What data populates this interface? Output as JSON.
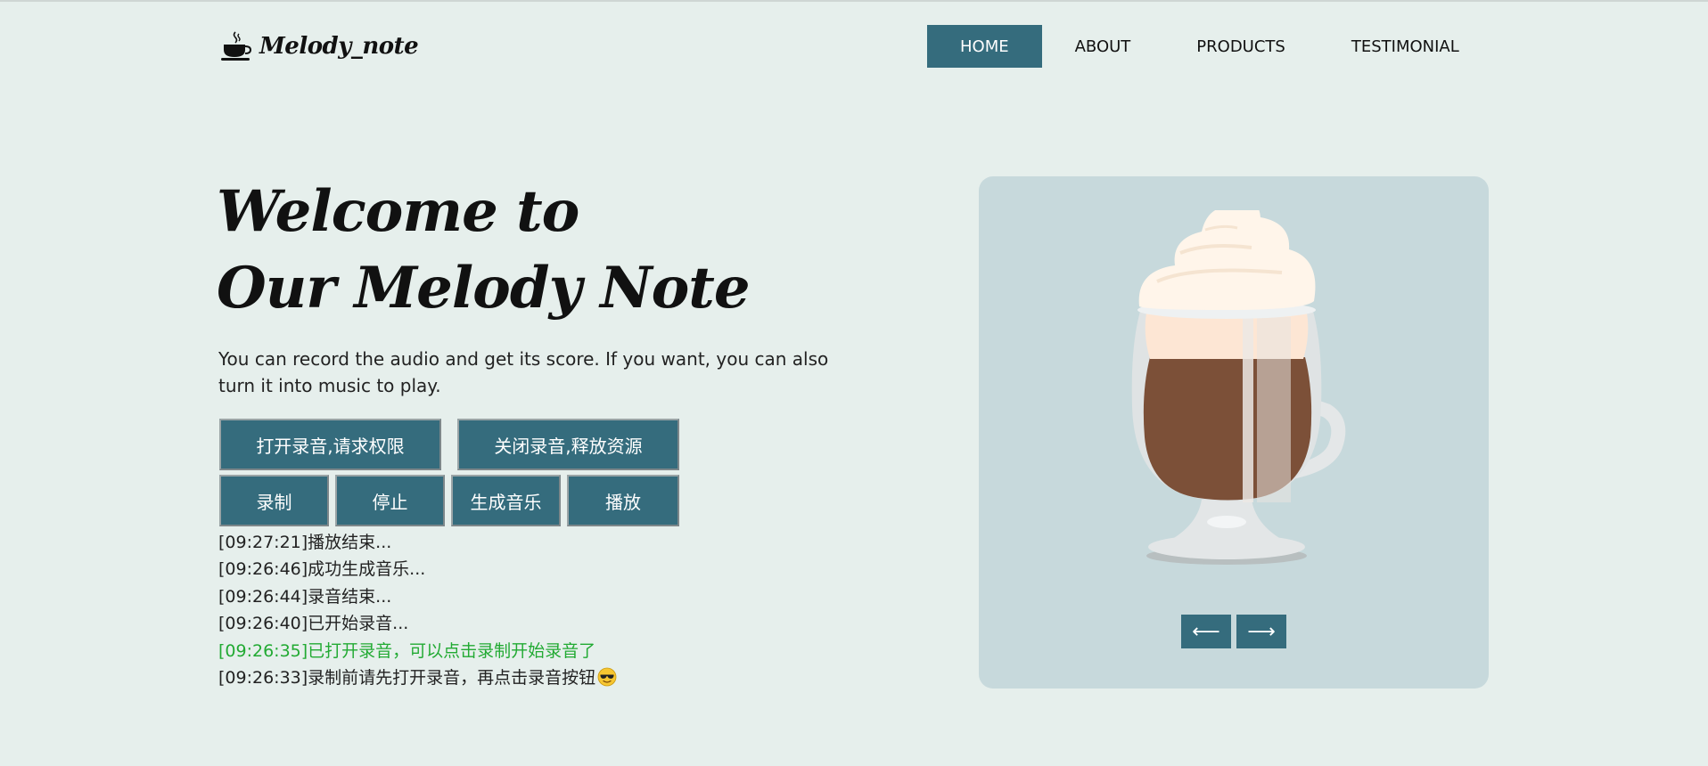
{
  "brand": {
    "name": "Melody_note",
    "icon": "coffee-cup-icon"
  },
  "nav": [
    {
      "label": "HOME",
      "active": true
    },
    {
      "label": "ABOUT",
      "active": false
    },
    {
      "label": "PRODUCTS",
      "active": false
    },
    {
      "label": "TESTIMONIAL",
      "active": false
    }
  ],
  "hero": {
    "title_line1": "Welcome to",
    "title_line2": "Our Melody Note",
    "description": "You can record the audio and get its score. If you want, you can also turn it into music to play."
  },
  "controls": {
    "open_label": "打开录音,请求权限",
    "close_label": "关闭录音,释放资源",
    "record_label": "录制",
    "stop_label": "停止",
    "generate_label": "生成音乐",
    "play_label": "播放"
  },
  "log": [
    {
      "text": "[09:27:21]播放结束...",
      "status": "normal"
    },
    {
      "text": "[09:26:46]成功生成音乐...",
      "status": "normal"
    },
    {
      "text": "[09:26:44]录音结束...",
      "status": "normal"
    },
    {
      "text": "[09:26:40]已开始录音...",
      "status": "normal"
    },
    {
      "text": "[09:26:35]已打开录音，可以点击录制开始录音了",
      "status": "success"
    },
    {
      "text": "[09:26:33]录制前请先打开录音，再点击录音按钮",
      "status": "normal",
      "emoji": "sunglasses-emoji"
    }
  ],
  "carousel": {
    "image": "irish-coffee-glass-illustration",
    "prev_icon": "arrow-left-icon",
    "next_icon": "arrow-right-icon",
    "prev_glyph": "⟵",
    "next_glyph": "⟶"
  },
  "colors": {
    "background": "#e6efec",
    "accent": "#356c7d",
    "card": "#c7d9dc",
    "success_text": "#22aa33"
  }
}
